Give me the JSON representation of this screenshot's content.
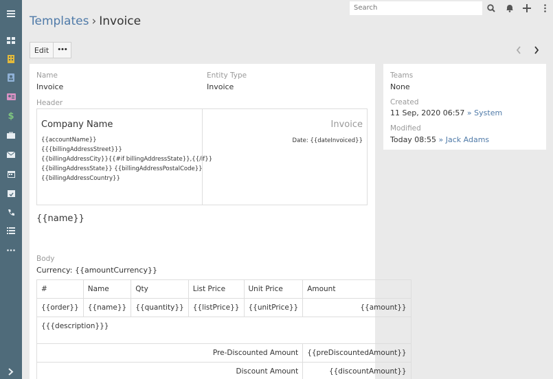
{
  "topbar": {
    "search_placeholder": "Search"
  },
  "breadcrumb": {
    "parent": "Templates",
    "separator": "›",
    "current": "Invoice"
  },
  "actions": {
    "edit_label": "Edit",
    "more_label": "•••"
  },
  "sidebar": {
    "icons": [
      "menu-icon",
      "dashboard-icon",
      "accounts-icon",
      "contacts-icon",
      "leads-icon",
      "opportunities-icon",
      "cases-icon",
      "email-icon",
      "calendar-icon",
      "meetings-icon",
      "calls-icon",
      "tasks-icon",
      "more-icon",
      "expand-icon"
    ]
  },
  "fields": {
    "name_label": "Name",
    "name_value": "Invoice",
    "entity_type_label": "Entity Type",
    "entity_type_value": "Invoice",
    "header_label": "Header",
    "body_label": "Body"
  },
  "header_template": {
    "company_name": "Company Name",
    "address_lines": [
      "{{accountName}}",
      "{{{billingAddressStreet}}}",
      "{{billingAddressCity}}{{#if billingAddressState}},{{/if}}",
      "{{billingAddressState}} {{billingAddressPostalCode}}",
      "{{billingAddressCountry}}"
    ],
    "doc_title": "Invoice",
    "date_line": "Date: {{dateInvoiced}}"
  },
  "body_template": {
    "name_placeholder": "{{name}}",
    "currency_line": "Currency: {{amountCurrency}}",
    "table_headers": [
      "#",
      "Name",
      "Qty",
      "List Price",
      "Unit Price",
      "Amount"
    ],
    "row": [
      "{{order}}",
      "{{name}}",
      "{{quantity}}",
      "{{listPrice}}",
      "{{unitPrice}}",
      "{{amount}}"
    ],
    "description": "{{{description}}}",
    "totals": [
      {
        "label": "Pre-Discounted Amount",
        "value": "{{preDiscountedAmount}}"
      },
      {
        "label": "Discount Amount",
        "value": "{{discountAmount}}"
      }
    ]
  },
  "side": {
    "teams_label": "Teams",
    "teams_value": "None",
    "created_label": "Created",
    "created_date": "11 Sep, 2020 06:57",
    "created_sep": "»",
    "created_by": "System",
    "modified_label": "Modified",
    "modified_date": "Today 08:55",
    "modified_sep": "»",
    "modified_by": "Jack Adams"
  }
}
